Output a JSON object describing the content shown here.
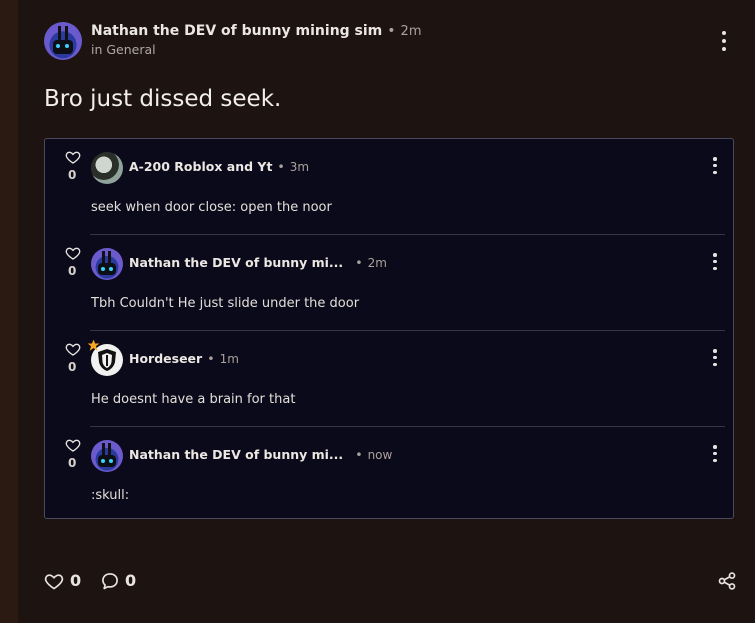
{
  "post": {
    "author": "Nathan the DEV of bunny mining sim",
    "time": "2m",
    "channel": "in General",
    "title": "Bro just dissed seek."
  },
  "replies": [
    {
      "likes": "0",
      "author": "A-200 Roblox and Yt",
      "time": "3m",
      "text": "seek when door close: open the noor",
      "avatar_icon": "gear-avatar"
    },
    {
      "likes": "0",
      "author": "Nathan the DEV of bunny mi...",
      "time": "2m",
      "text": "Tbh Couldn't He just slide under the door",
      "avatar_icon": "bunny-avatar"
    },
    {
      "likes": "0",
      "author": "Hordeseer",
      "time": "1m",
      "text": "He doesnt have a brain for that",
      "avatar_icon": "shield-avatar"
    },
    {
      "likes": "0",
      "author": "Nathan the DEV of bunny mi...",
      "time": "now",
      "text": ":skull:",
      "avatar_icon": "bunny-avatar"
    }
  ],
  "footer": {
    "likes": "0",
    "comments": "0"
  },
  "separator": "•",
  "colors": {
    "background": "#1d1412",
    "thread_background": "#0b0a1a",
    "thread_border": "#4a4a5c",
    "text": "#e8e4df",
    "muted": "#a9a19a"
  }
}
